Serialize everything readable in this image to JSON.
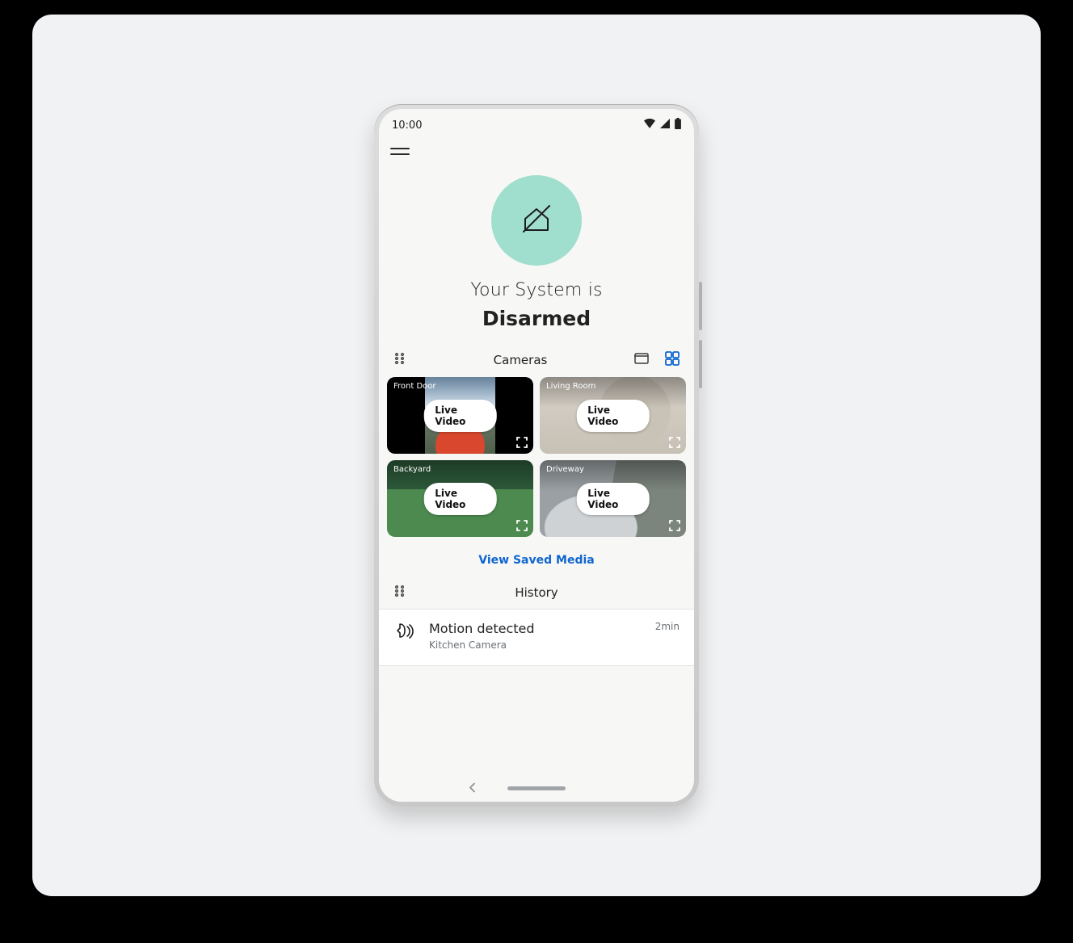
{
  "status_bar": {
    "time": "10:00"
  },
  "system": {
    "line1": "Your System is",
    "state": "Disarmed"
  },
  "cameras": {
    "section_title": "Cameras",
    "live_button_label": "Live Video",
    "saved_media_label": "View Saved Media",
    "items": [
      {
        "name": "Front Door"
      },
      {
        "name": "Living Room"
      },
      {
        "name": "Backyard"
      },
      {
        "name": "Driveway"
      }
    ]
  },
  "history": {
    "section_title": "History",
    "items": [
      {
        "title": "Motion detected",
        "subtitle": "Kitchen Camera",
        "time": "2min"
      }
    ]
  },
  "colors": {
    "accent": "#0f66d0",
    "mint": "#a0decd"
  }
}
